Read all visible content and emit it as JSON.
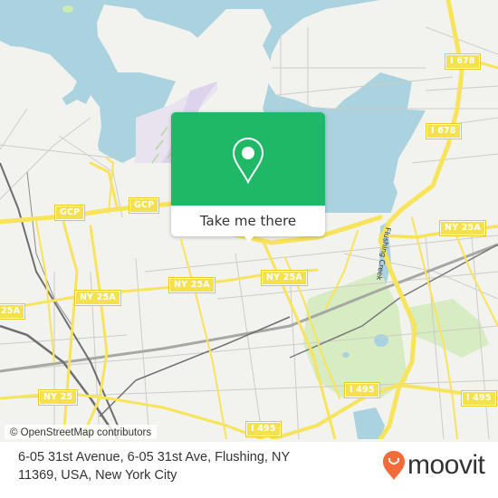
{
  "map": {
    "attribution": "© OpenStreetMap contributors",
    "colors": {
      "water": "#aad3df",
      "land": "#f2f2ef",
      "park": "#cdebb0",
      "road_major": "#f7e45c",
      "road_casing": "#e8cf3a",
      "road_minor": "#c8c5bd",
      "rail": "#8a8a8a",
      "airport": "#e6dff0"
    },
    "shields": [
      {
        "label": "GCP"
      },
      {
        "label": "GCP"
      },
      {
        "label": "I 678"
      },
      {
        "label": "I 678"
      },
      {
        "label": "NY 25A"
      },
      {
        "label": "NY 25A"
      },
      {
        "label": "NY 25A"
      },
      {
        "label": "NY 25A"
      },
      {
        "label": "25A"
      },
      {
        "label": "NY 25"
      },
      {
        "label": "I 495"
      },
      {
        "label": "I 495"
      },
      {
        "label": "I 495"
      }
    ],
    "waterway_label": "Flushing Creek"
  },
  "popup": {
    "button_label": "Take me there",
    "accent_color": "#1fb866",
    "icon": "map-pin-icon"
  },
  "footer": {
    "address": "6-05 31st Avenue, 6-05 31st Ave, Flushing, NY 11369, USA, New York City",
    "logo_text": "moovit",
    "logo_color": "#f26b3a"
  }
}
